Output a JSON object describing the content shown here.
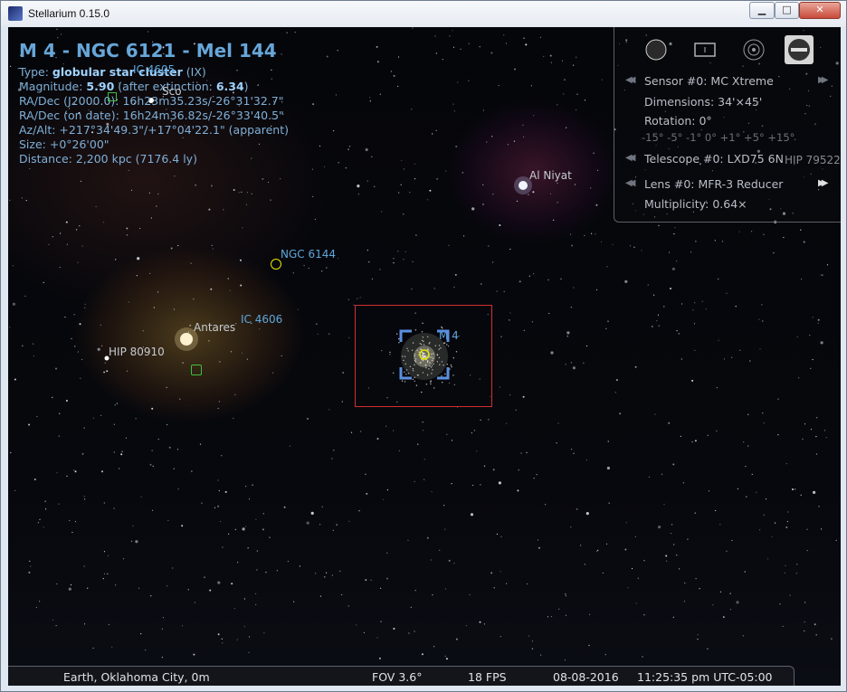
{
  "window": {
    "title": "Stellarium 0.15.0",
    "min_glyph": "▁",
    "max_glyph": "□",
    "close_glyph": "✕"
  },
  "object_info": {
    "title": "M 4 - NGC 6121 - Mel 144",
    "type_label": "Type: ",
    "type_value": "globular star cluster",
    "type_class": " (IX)",
    "magnitude_label": "Magnitude: ",
    "magnitude_value": "5.90",
    "magnitude_after_label": " (after extinction: ",
    "magnitude_after_value": "6.34",
    "magnitude_close": ")",
    "radec_j2000": "RA/Dec (J2000.0): 16h23m35.23s/-26°31'32.7\"",
    "radec_date": "RA/Dec (on date): 16h24m36.82s/-26°33'40.5\"",
    "azalt": "Az/Alt: +217°34'49.3\"/+17°04'22.1\" (apparent)",
    "size": "Size: +0°26'00\"",
    "distance": "Distance: 2,200 kpc (7176.4 ly)"
  },
  "sky_labels": {
    "ic4605": "IC 4605",
    "sco": "Sco",
    "al_niyat": "Al Niyat",
    "ngc6144": "NGC 6144",
    "ic4606": "IC 4606",
    "antares": "Antares",
    "hip80910": "HIP 80910",
    "m4": "M 4",
    "hip_partial": "HIP 79522"
  },
  "oculars_panel": {
    "sensor": "Sensor #0: MC Xtreme",
    "dimensions": "Dimensions: 34'×45'",
    "rotation": "Rotation: 0°",
    "rotation_steps": "-15° -5° -1° 0° +1° +5° +15°",
    "telescope": "Telescope #0: LXD75 6N",
    "lens": "Lens #0: MFR-3 Reducer",
    "multiplicity": "Multiplicity: 0.64×"
  },
  "status_bar": {
    "location": "Earth, Oklahoma City, 0m",
    "fov": "FOV 3.6°",
    "fps": "18 FPS",
    "date": "08-08-2016",
    "time": "11:25:35 pm UTC-05:00"
  },
  "colors": {
    "sensor_frame": "#d03030",
    "dso_label": "#5ea7dc",
    "info_text": "#7fb0d8"
  }
}
